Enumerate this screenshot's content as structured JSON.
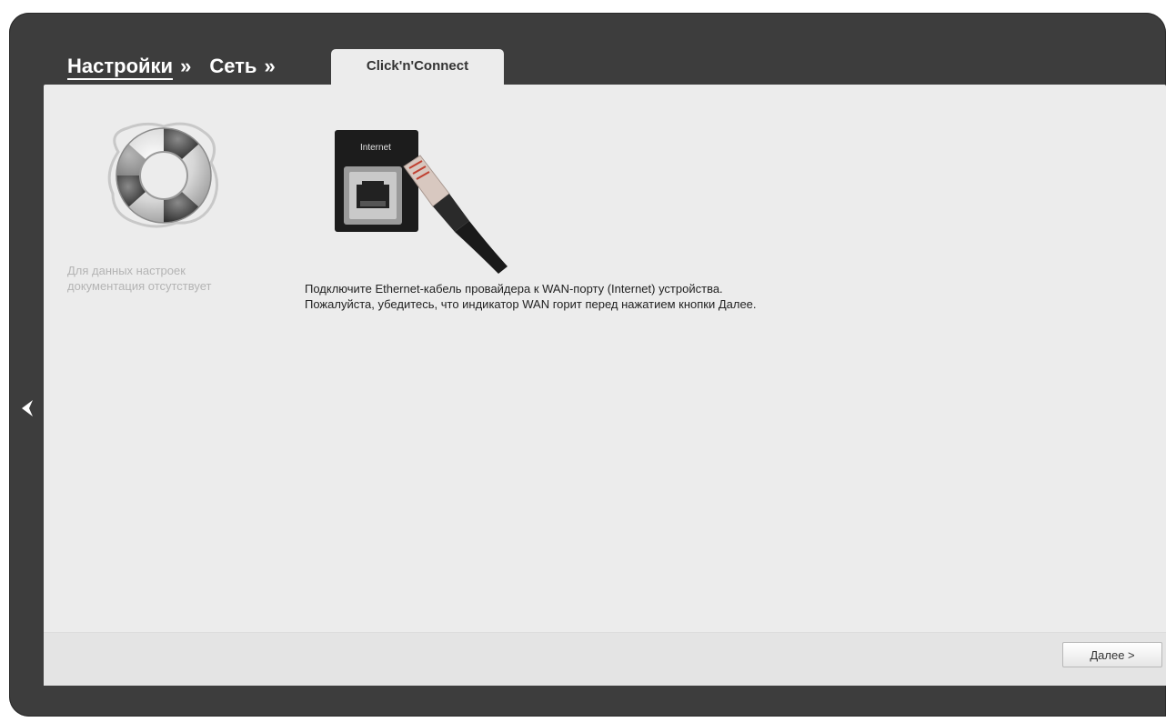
{
  "breadcrumb": {
    "items": [
      {
        "label": "Настройки",
        "sep": "»"
      },
      {
        "label": "Сеть",
        "sep": "»"
      }
    ],
    "active_tab": "Click'n'Connect"
  },
  "sidebar": {
    "help_icon": "lifebuoy-icon",
    "help_text_line1": "Для данных настроек",
    "help_text_line2": "документация отсутствует"
  },
  "main": {
    "image": "ethernet-port-cable-icon",
    "image_label": "Internet",
    "instruction_line1": "Подключите Ethernet-кабель провайдера к WAN-порту (Internet) устройства.",
    "instruction_line2": "Пожалуйста, убедитесь, что индикатор WAN горит перед нажатием кнопки Далее."
  },
  "footer": {
    "next_label": "Далее >"
  },
  "nav": {
    "back_icon": "back-arrow-icon"
  },
  "colors": {
    "frame": "#3d3d3d",
    "panel": "#ececec",
    "tab": "#ececec",
    "help_text": "#b4b4b4",
    "text": "#222222"
  }
}
